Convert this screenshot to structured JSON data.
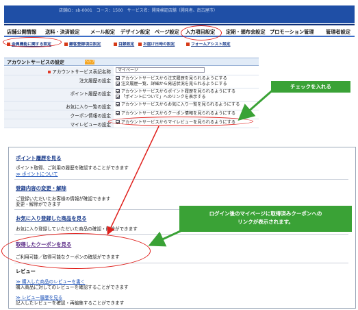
{
  "admin": {
    "header_text": "店舗ID：sb-0001　コース：1500　サービス名：開発検証店舗（開発者、南古屋市）",
    "nav": [
      "店舗公開情報",
      "送料・決済設定",
      "メール設定",
      "デザイン設定",
      "ページ設定",
      "入力項目設定",
      "定期・頒布会設定",
      "プロモーション管理",
      "管理者設定"
    ],
    "subnav": [
      "会員機能に関する設定",
      "顧客登録項目設定",
      "目録設定",
      "お届け日時の設定",
      "フォームアシスト設定"
    ],
    "section_title": "アカウントサービスの設定",
    "help_badge": "ヘルプ",
    "rows": [
      {
        "label": "アカウントサービス表記名称",
        "value": "マイページ"
      },
      {
        "label": "注文履歴の設定",
        "options": [
          "アカウントサービスから注文履歴を見られるようにする",
          "注文履歴一覧、詳細から発送状況を見られるようにする"
        ]
      },
      {
        "label": "ポイント履歴の設定",
        "options": [
          "アカウントサービスからポイント履歴を見られるようにする",
          "「ポイントについて」へのリンクを表示する"
        ]
      },
      {
        "label": "お気に入り一覧の設定",
        "options": [
          "アカウントサービスからお気に入り一覧を見られるようにする"
        ]
      },
      {
        "label": "クーポン情報の設定",
        "options": [
          "アカウントサービスからクーポン情報を見られるようにする"
        ]
      },
      {
        "label": "マイレビューの設定",
        "options": [
          "アカウントサービスからマイレビューを見られるようにする"
        ]
      }
    ]
  },
  "callouts": {
    "check": "チェックを入れる",
    "coupon_line1": "ログイン後のマイページに取得済みクーポンへの",
    "coupon_line2": "リンクが表示されます。"
  },
  "mypage": {
    "point_title": "ポイント履歴を見る",
    "point_desc": "ポイント取得、ご利用の履歴を確認することができます",
    "point_link": "≫ ポイントについて",
    "member_title": "登録内容の変更・解除",
    "member_desc1": "ご登録いただいたお客様の情報が確認できます",
    "member_desc2": "変更・解除ができます",
    "fav_title": "お気に入り登録した商品を見る",
    "fav_desc": "お気に入り登録していただいた商品の確認・削除ができます",
    "coupon_title": "取得したクーポンを見る",
    "coupon_desc": "ご利用可能／取得可能なクーポンの確認ができます",
    "review_title": "レビュー",
    "review_link1": "≫ 購入した商品のレビューを書く",
    "review_desc1": "購入商品に対してのレビューを確認することができます",
    "review_link2": "≫ レビュー履歴を見る",
    "review_desc2": "記入したレビューを確認・再編集することができます"
  },
  "colors": {
    "header_blue": "#1f4fa6",
    "callout_red": "#e0201c",
    "callout_green": "#3aa236"
  }
}
